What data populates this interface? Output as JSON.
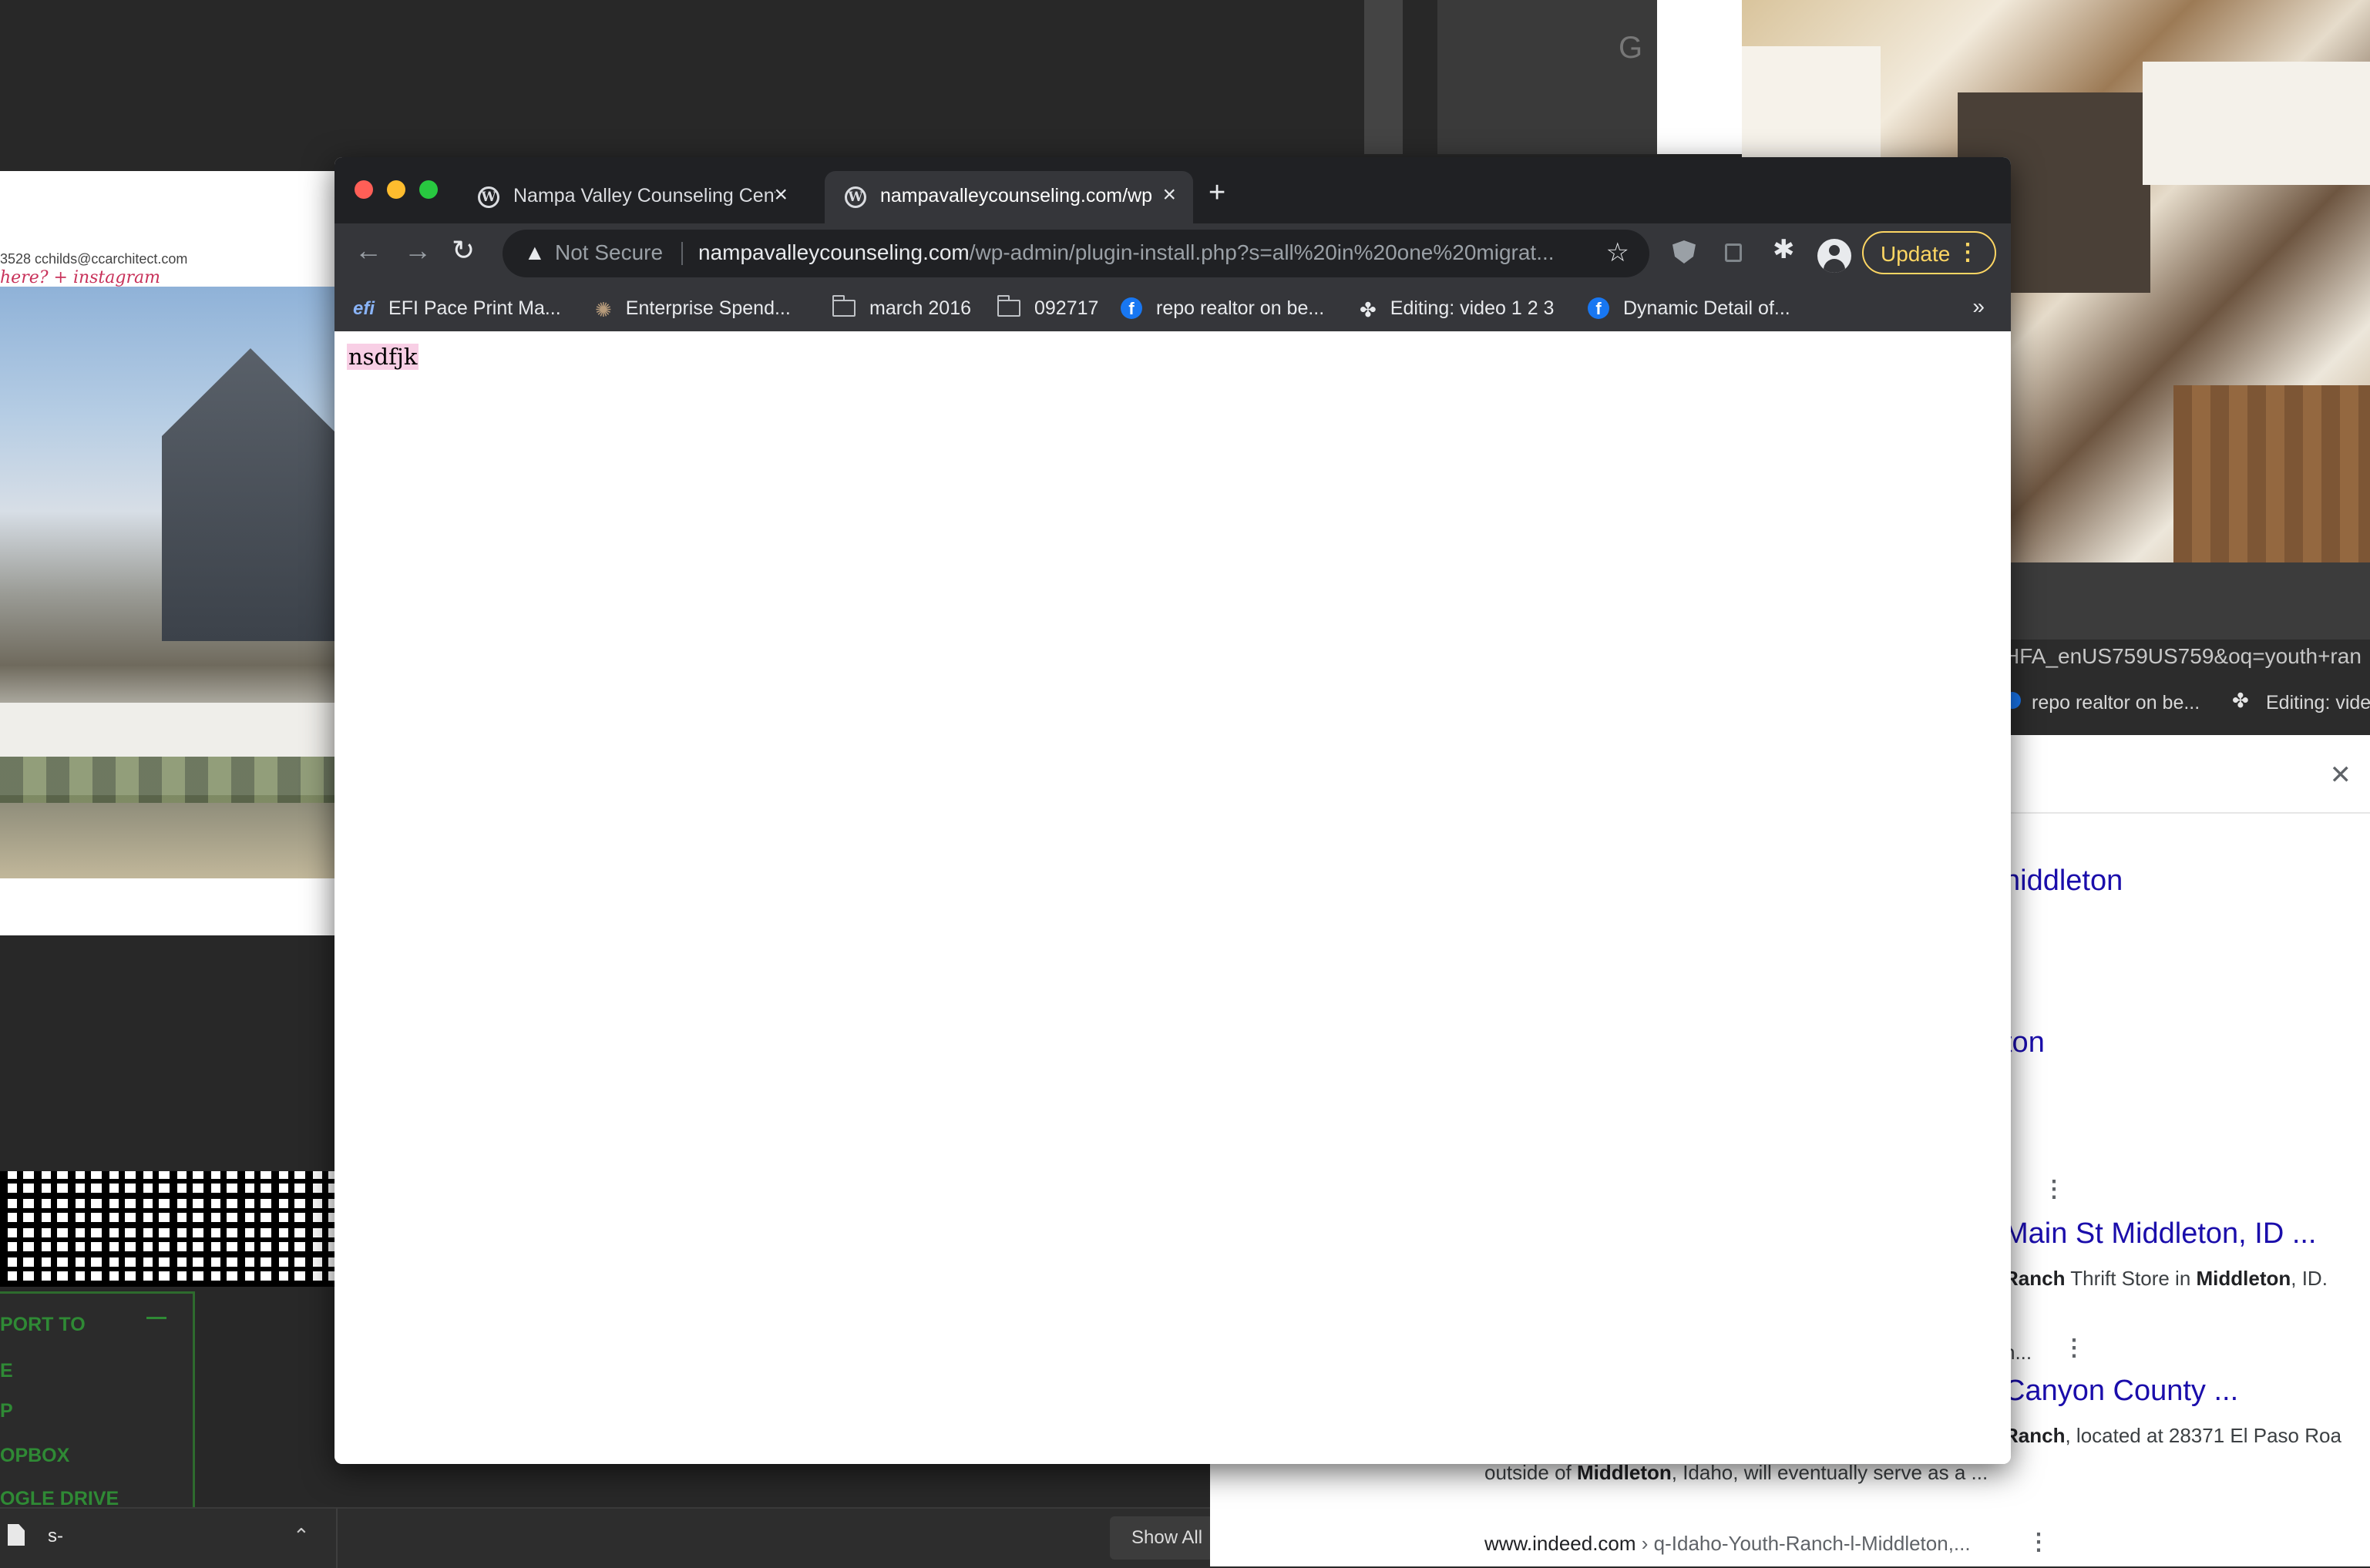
{
  "background": {
    "left_doc": {
      "contact": "3528        cchilds@ccarchitect.com",
      "scribble": "here?   + instagram"
    },
    "export_panel": {
      "items": [
        "PORT TO",
        "E",
        "P",
        "OPBOX",
        "OGLE DRIVE"
      ]
    },
    "download_bar": {
      "file_name": "s-",
      "show_all": "Show All"
    },
    "gmail_letter": "G",
    "right_browser": {
      "url_fragment": "HFA_enUS759US759&oq=youth+ran",
      "bookmark_1": "repo realtor on be...",
      "bookmark_2": "Editing: vide"
    },
    "search_results": [
      {
        "type": "link",
        "text": "niddleton"
      },
      {
        "type": "link",
        "text": "ton"
      },
      {
        "type": "link",
        "text": "Main St Middleton, ID ..."
      },
      {
        "type": "snippet_pre",
        "text": " Ranch"
      },
      {
        "type": "snippet_mid",
        "text": " Thrift Store in "
      },
      {
        "type": "snippet_bold",
        "text": "Middleton"
      },
      {
        "type": "snippet_end",
        "text": ", ID."
      },
      {
        "type": "snippet_top",
        "text": "n..."
      },
      {
        "type": "link",
        "text": "Canyon County ..."
      },
      {
        "type": "snippet2_pre",
        "text": " Ranch"
      },
      {
        "type": "snippet2_rest",
        "text": ", located at 28371 El Paso Roa"
      },
      {
        "type": "snippet3_pre",
        "text": "outside of "
      },
      {
        "type": "snippet3_bold",
        "text": "Middleton"
      },
      {
        "type": "snippet3_rest",
        "text": ", Idaho, will eventually serve as a ..."
      },
      {
        "type": "cite_host",
        "text": "www.indeed.com"
      },
      {
        "type": "cite_path",
        "text": " › q-Idaho-Youth-Ranch-l-Middleton,..."
      }
    ]
  },
  "browser": {
    "tabs": [
      {
        "title": "Nampa Valley Counseling Cent",
        "active": false,
        "icon": "wordpress-icon"
      },
      {
        "title": "nampavalleycounseling.com/wp",
        "active": true,
        "icon": "wordpress-icon"
      }
    ],
    "new_tab": "+",
    "omnibox": {
      "security": "Not Secure",
      "url_host": "nampavalleycounseling.com",
      "url_path": "/wp-admin/plugin-install.php?s=all%20in%20one%20migrat..."
    },
    "update_label": "Update",
    "bookmarks": [
      {
        "label": "EFI Pace Print Ma...",
        "icon": "efi-icon"
      },
      {
        "label": "Enterprise Spend...",
        "icon": "hedgehog-icon"
      },
      {
        "label": "march 2016",
        "icon": "folder-icon"
      },
      {
        "label": "092717",
        "icon": "folder-icon"
      },
      {
        "label": "repo realtor on be...",
        "icon": "facebook-icon"
      },
      {
        "label": "Editing: video 1 2 3",
        "icon": "leaf-icon"
      },
      {
        "label": "Dynamic Detail of...",
        "icon": "facebook-icon"
      }
    ],
    "bookmarks_more": "»",
    "page_text": "nsdfjk"
  },
  "colors": {
    "window_frame": "#202124",
    "toolbar": "#35363a",
    "update_accent": "#fdd663",
    "highlight": "#f8cfe5",
    "close_red": "#ff5f57",
    "minimize_yellow": "#febc2e",
    "zoom_green": "#28c840"
  }
}
